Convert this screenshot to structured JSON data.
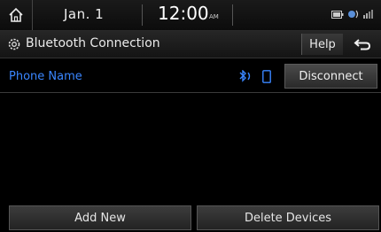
{
  "status_bar": {
    "date": "Jan. 1",
    "time": "12:00",
    "ampm": "AM"
  },
  "title_bar": {
    "title": "Bluetooth Connection",
    "help_label": "Help"
  },
  "device": {
    "name": "Phone Name",
    "disconnect_label": "Disconnect"
  },
  "footer": {
    "add_new_label": "Add New",
    "delete_devices_label": "Delete Devices"
  },
  "colors": {
    "accent": "#3a86ff",
    "background": "#000000"
  }
}
